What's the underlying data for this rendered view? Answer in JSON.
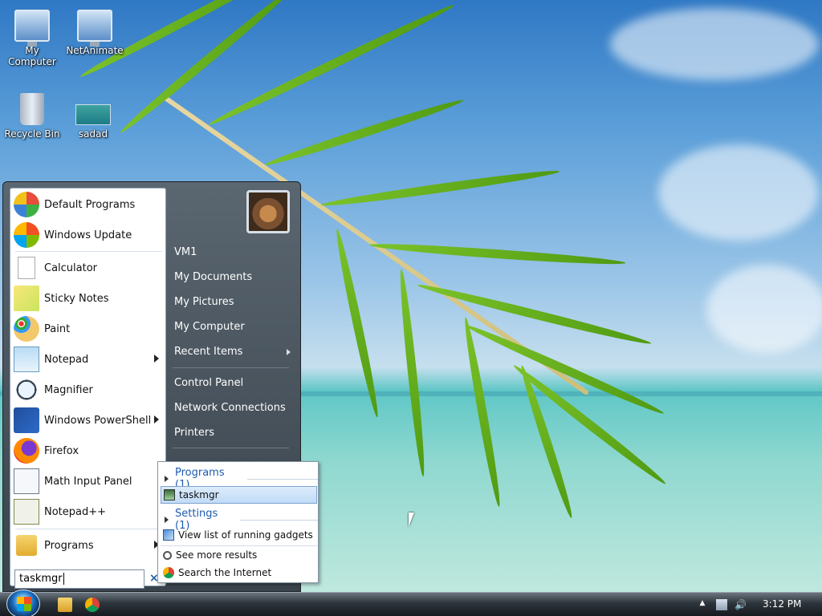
{
  "desktop": {
    "icons": [
      {
        "label": "My Computer",
        "icon": "computer-icon"
      },
      {
        "label": "NetAnimate",
        "icon": "network-shortcut-icon"
      },
      {
        "label": "Recycle Bin",
        "icon": "recycle-bin-icon"
      },
      {
        "label": "sadad",
        "icon": "image-file-icon"
      }
    ]
  },
  "start_menu": {
    "pinned": [
      {
        "label": "Default Programs",
        "icon": "default-programs-icon"
      },
      {
        "label": "Windows Update",
        "icon": "windows-update-icon"
      }
    ],
    "recent": [
      {
        "label": "Calculator",
        "icon": "calculator-icon",
        "submenu": false
      },
      {
        "label": "Sticky Notes",
        "icon": "sticky-notes-icon",
        "submenu": false
      },
      {
        "label": "Paint",
        "icon": "paint-icon",
        "submenu": false
      },
      {
        "label": "Notepad",
        "icon": "notepad-icon",
        "submenu": true
      },
      {
        "label": "Magnifier",
        "icon": "magnifier-icon",
        "submenu": false
      },
      {
        "label": "Windows PowerShell",
        "icon": "powershell-icon",
        "submenu": true
      },
      {
        "label": "Firefox",
        "icon": "firefox-icon",
        "submenu": false
      },
      {
        "label": "Math Input Panel",
        "icon": "math-input-icon",
        "submenu": false
      },
      {
        "label": "Notepad++",
        "icon": "notepad-plus-plus-icon",
        "submenu": false
      }
    ],
    "programs_label": "Programs",
    "search": {
      "value": "taskmgr",
      "clear_symbol": "×"
    },
    "right_pane": {
      "user": "VM1",
      "items": [
        "My Documents",
        "My Pictures",
        "My Computer",
        "Recent Items",
        "Control Panel",
        "Network Connections",
        "Printers"
      ]
    },
    "results": {
      "programs_header": "Programs (1)",
      "program_item": "taskmgr",
      "settings_header": "Settings (1)",
      "settings_item": "View list of running gadgets",
      "see_more": "See more results",
      "search_internet": "Search the Internet"
    }
  },
  "taskbar": {
    "clock": "3:12 PM",
    "pinned": [
      "file-explorer-icon",
      "chrome-icon"
    ],
    "tray": [
      "show-hidden-icons-icon",
      "network-icon",
      "volume-icon"
    ]
  }
}
